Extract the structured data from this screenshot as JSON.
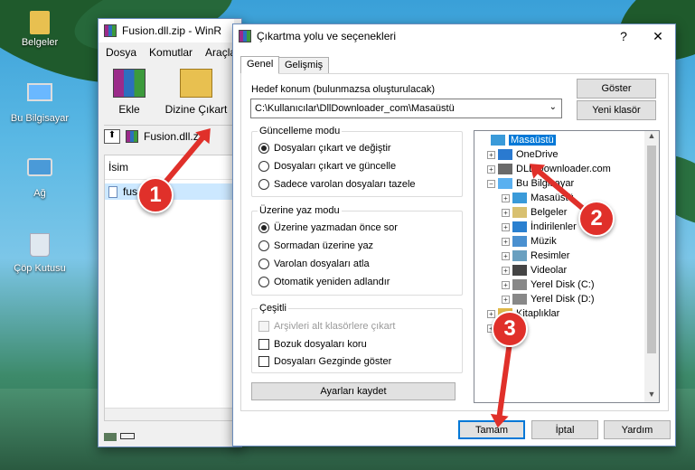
{
  "desktop": {
    "icons": [
      {
        "label": "Belgeler",
        "icon": "folder-icon"
      },
      {
        "label": "Bu Bilgisayar",
        "icon": "computer-icon"
      },
      {
        "label": "Ağ",
        "icon": "network-icon"
      },
      {
        "label": "Çöp Kutusu",
        "icon": "recycle-bin-icon"
      }
    ]
  },
  "winrar": {
    "title": "Fusion.dll.zip - WinR",
    "menu": [
      "Dosya",
      "Komutlar",
      "Araçla"
    ],
    "toolbar": {
      "add_label": "Ekle",
      "extract_label": "Dizine Çıkart"
    },
    "path": "Fusion.dll.za",
    "column_name": "İsim",
    "file_name": "fus"
  },
  "dialog": {
    "title": "Çıkartma yolu ve seçenekleri",
    "help_btn": "?",
    "close_btn": "✕",
    "tabs": [
      "Genel",
      "Gelişmiş"
    ],
    "dest_label": "Hedef konum (bulunmazsa oluşturulacak)",
    "dest_value": "C:\\Kullanıcılar\\DllDownloader_com\\Masaüstü",
    "show_btn": "Göster",
    "new_folder_btn": "Yeni klasör",
    "update_mode": {
      "label": "Güncelleme modu",
      "options": [
        "Dosyaları çıkart ve değiştir",
        "Dosyaları çıkart ve güncelle",
        "Sadece varolan dosyaları tazele"
      ],
      "selected": 0
    },
    "overwrite_mode": {
      "label": "Üzerine yaz modu",
      "options": [
        "Üzerine yazmadan önce sor",
        "Sormadan üzerine yaz",
        "Varolan dosyaları atla",
        "Otomatik yeniden adlandır"
      ],
      "selected": 0
    },
    "misc": {
      "label": "Çeşitli",
      "options": [
        "Arşivleri alt klasörlere çıkart",
        "Bozuk dosyaları koru",
        "Dosyaları Gezginde göster"
      ]
    },
    "save_settings_btn": "Ayarları kaydet",
    "tree": [
      {
        "label": "Masaüstü",
        "icon": "desktop-icon",
        "selected": true
      },
      {
        "label": "OneDrive",
        "icon": "cloud-icon"
      },
      {
        "label": "DLL Downloader.com",
        "icon": "user-icon"
      },
      {
        "label": "Bu Bilgisayar",
        "icon": "computer-icon"
      },
      {
        "label": "Masaüstü",
        "icon": "desktop-icon"
      },
      {
        "label": "Belgeler",
        "icon": "documents-icon"
      },
      {
        "label": "İndirilenler",
        "icon": "download-icon"
      },
      {
        "label": "Müzik",
        "icon": "music-icon"
      },
      {
        "label": "Resimler",
        "icon": "pictures-icon"
      },
      {
        "label": "Videolar",
        "icon": "video-icon"
      },
      {
        "label": "Yerel Disk (C:)",
        "icon": "drive-icon"
      },
      {
        "label": "Yerel Disk (D:)",
        "icon": "drive-icon"
      },
      {
        "label": "Kitaplıklar",
        "icon": "library-icon"
      },
      {
        "label": "",
        "icon": "network-icon"
      }
    ],
    "ok_btn": "Tamam",
    "cancel_btn": "İptal",
    "help_text_btn": "Yardım"
  },
  "annotations": [
    "1",
    "2",
    "3"
  ],
  "colors": {
    "accent": "#0078d7",
    "marker": "#e0302a"
  }
}
